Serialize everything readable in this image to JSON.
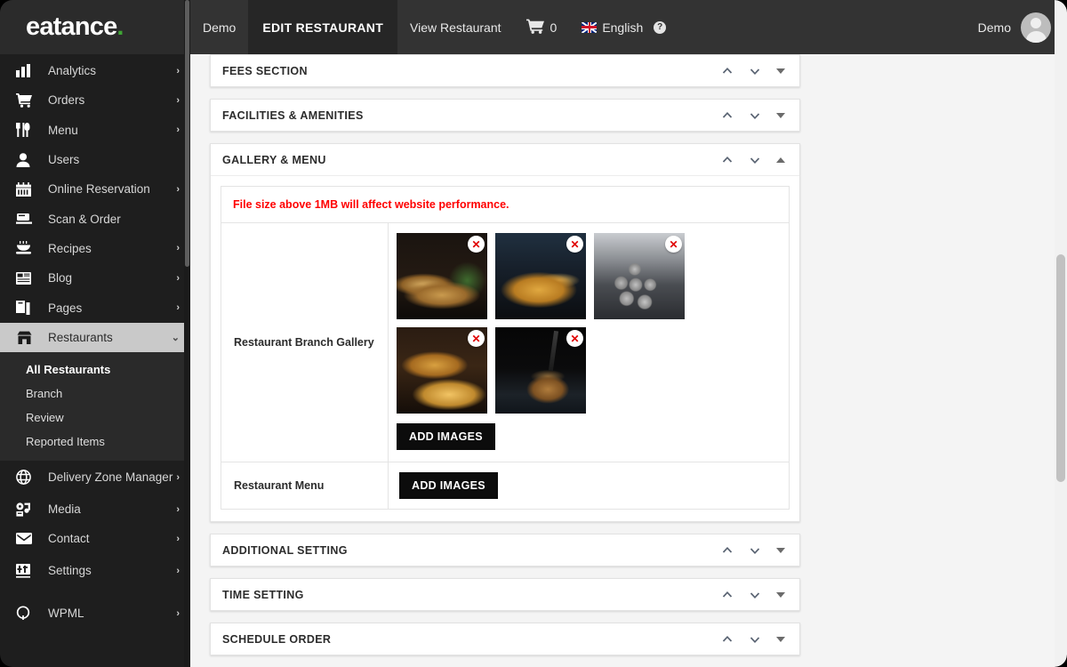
{
  "brand": {
    "name": "eatance",
    "dot": "."
  },
  "topbar": {
    "items": [
      {
        "label": "Demo",
        "active": false
      },
      {
        "label": "EDIT RESTAURANT",
        "active": true
      },
      {
        "label": "View Restaurant",
        "active": false
      }
    ],
    "cart_count": "0",
    "language": "English",
    "language_flag": "uk-flag-icon",
    "help": "?",
    "user": "Demo",
    "avatar": "user-avatar"
  },
  "sidebar": {
    "items": [
      {
        "label": "Analytics",
        "icon": "bar-chart-icon",
        "arrow": "›"
      },
      {
        "label": "Orders",
        "icon": "cart-icon",
        "arrow": "›"
      },
      {
        "label": "Menu",
        "icon": "cutlery-icon",
        "arrow": "›"
      },
      {
        "label": "Users",
        "icon": "user-icon",
        "arrow": ""
      },
      {
        "label": "Online Reservation",
        "icon": "calendar-icon",
        "arrow": "›"
      },
      {
        "label": "Scan & Order",
        "icon": "scan-icon",
        "arrow": ""
      },
      {
        "label": "Recipes",
        "icon": "recipe-icon",
        "arrow": "›"
      },
      {
        "label": "Blog",
        "icon": "blog-icon",
        "arrow": "›"
      },
      {
        "label": "Pages",
        "icon": "pages-icon",
        "arrow": "›"
      },
      {
        "label": "Restaurants",
        "icon": "store-icon",
        "arrow": "⌄",
        "active": true
      },
      {
        "label": "Delivery Zone Manager",
        "icon": "globe-icon",
        "arrow": "›"
      },
      {
        "label": "Media",
        "icon": "media-icon",
        "arrow": "›"
      },
      {
        "label": "Contact",
        "icon": "envelope-icon",
        "arrow": "›"
      },
      {
        "label": "Settings",
        "icon": "sliders-icon",
        "arrow": "›"
      },
      {
        "label": "WPML",
        "icon": "wpml-icon",
        "arrow": "›"
      }
    ],
    "submenu": [
      {
        "label": "All Restaurants",
        "bold": true
      },
      {
        "label": "Branch",
        "bold": false
      },
      {
        "label": "Review",
        "bold": false
      },
      {
        "label": "Reported Items",
        "bold": false
      }
    ]
  },
  "panels": {
    "fees": {
      "title": "FEES SECTION",
      "state": "collapsed"
    },
    "facilities": {
      "title": "FACILITIES & AMENITIES",
      "state": "collapsed"
    },
    "gallery": {
      "title": "GALLERY & MENU",
      "state": "expanded",
      "warning": "File size above 1MB will affect website performance.",
      "rows": [
        {
          "label": "Restaurant Branch Gallery",
          "button": "ADD IMAGES"
        },
        {
          "label": "Restaurant Menu",
          "button": "ADD IMAGES"
        }
      ],
      "images": [
        {
          "name": "empanadas-in-pan",
          "delete": "✕"
        },
        {
          "name": "french-fries-bowl",
          "delete": "✕"
        },
        {
          "name": "powdered-donut-holes",
          "delete": "✕"
        },
        {
          "name": "burger-with-fries",
          "delete": "✕"
        },
        {
          "name": "burger-with-knife",
          "delete": "✕"
        }
      ]
    },
    "additional": {
      "title": "ADDITIONAL SETTING",
      "state": "collapsed"
    },
    "time": {
      "title": "TIME SETTING",
      "state": "collapsed"
    },
    "schedule": {
      "title": "SCHEDULE ORDER",
      "state": "collapsed"
    }
  },
  "colors": {
    "brand_dot": "#3fa535",
    "warning": "#ff0000",
    "sidebar_bg": "#1e1e1e",
    "topbar_bg": "#333333",
    "active_nav": "#c9c9c9",
    "button_bg": "#0c0c0c"
  }
}
